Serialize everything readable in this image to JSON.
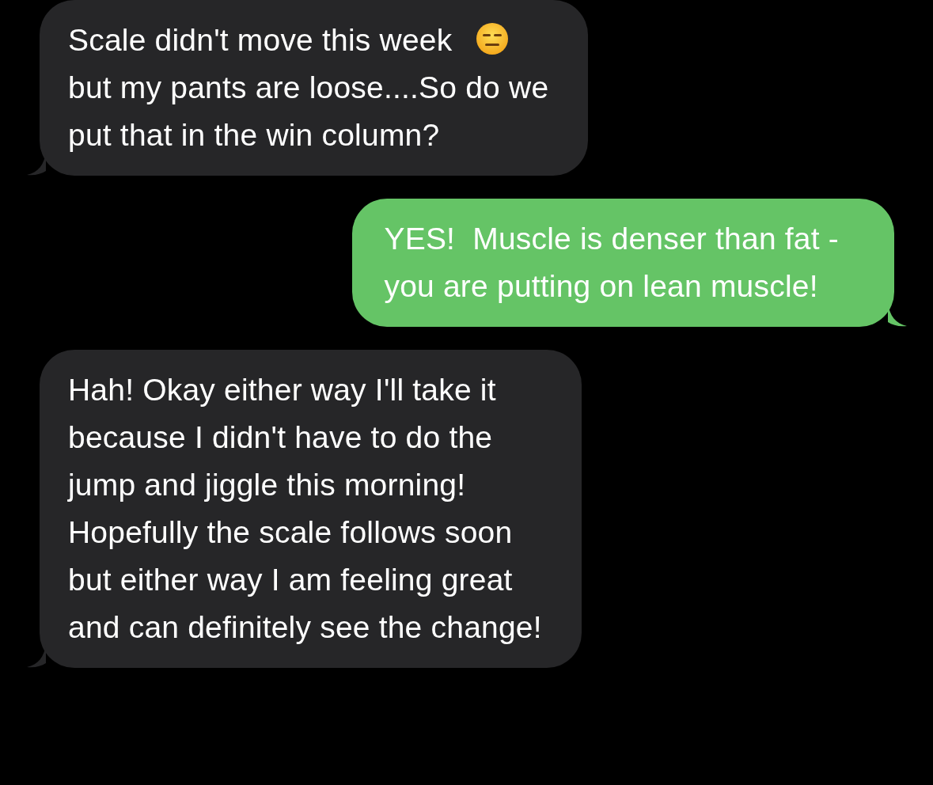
{
  "messages": [
    {
      "kind": "received",
      "text": "Scale didn't move this week",
      "emoji": true,
      "more": "but my pants are loose....So do we\nput that in the win column?"
    },
    {
      "kind": "sent",
      "text": "YES!  Muscle is denser than fat -\nyou are putting on lean muscle!"
    },
    {
      "kind": "received",
      "text": "Hah! Okay either way I'll take it\nbecause I didn't have to do the\njump and jiggle this morning!\nHopefully the scale follows soon\nbut either way I am feeling great\nand can definitely see the change!"
    }
  ]
}
